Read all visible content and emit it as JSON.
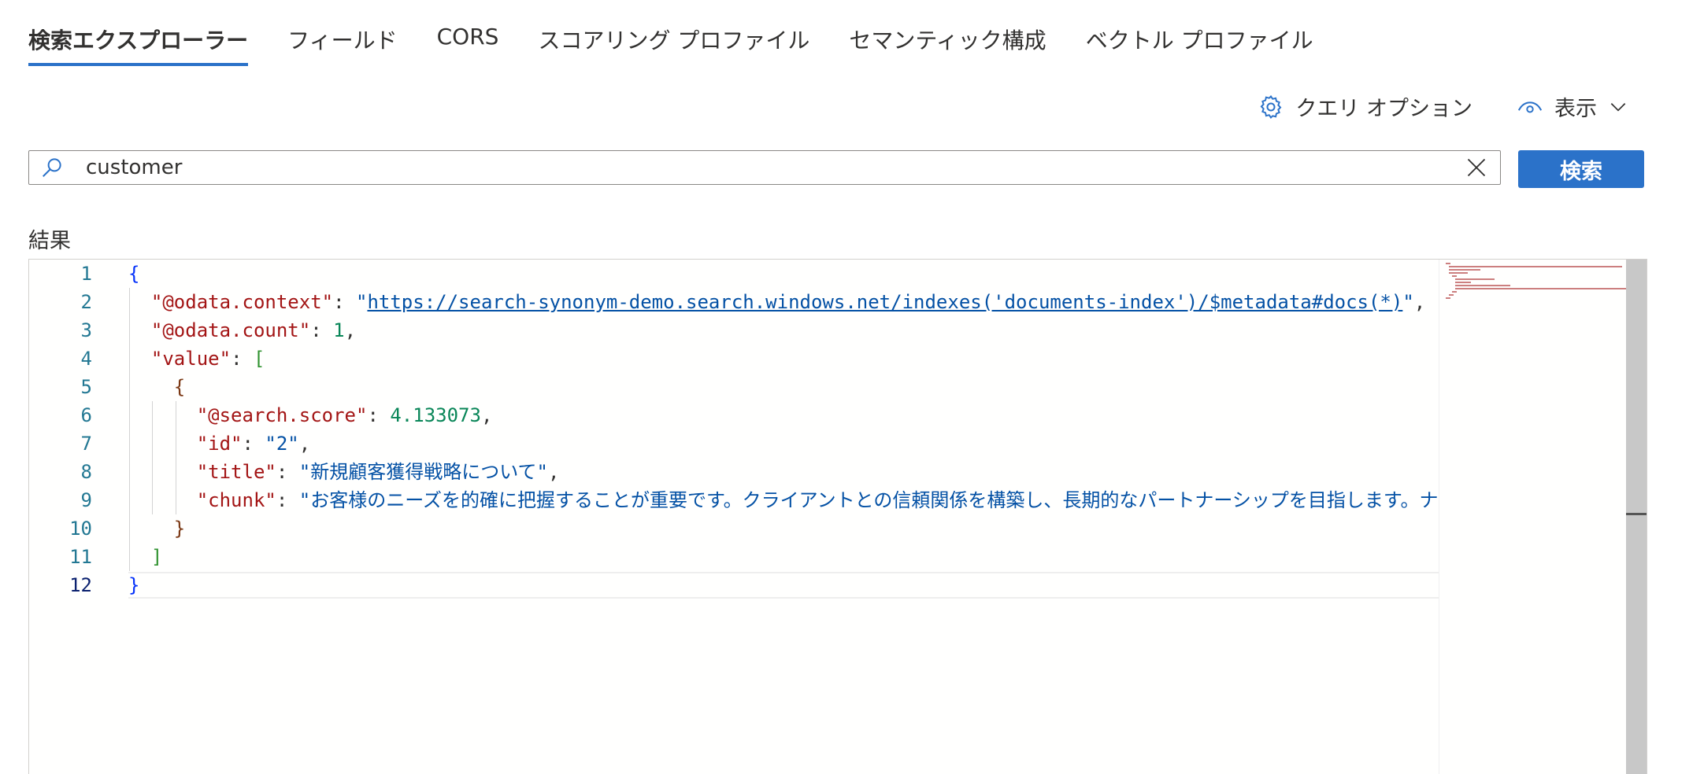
{
  "tabs": [
    {
      "label": "検索エクスプローラー",
      "active": true
    },
    {
      "label": "フィールド",
      "active": false
    },
    {
      "label": "CORS",
      "active": false
    },
    {
      "label": "スコアリング プロファイル",
      "active": false
    },
    {
      "label": "セマンティック構成",
      "active": false
    },
    {
      "label": "ベクトル プロファイル",
      "active": false
    }
  ],
  "toolbar": {
    "query_options_label": "クエリ オプション",
    "view_label": "表示"
  },
  "search": {
    "value": "customer",
    "button_label": "検索"
  },
  "results": {
    "label": "結果",
    "line_numbers": [
      "1",
      "2",
      "3",
      "4",
      "5",
      "6",
      "7",
      "8",
      "9",
      "10",
      "11",
      "12"
    ],
    "current_line": "12",
    "json": {
      "context_key": "\"@odata.context\"",
      "context_url": "https://search-synonym-demo.search.windows.net/indexes('documents-index')/$metadata#docs(*)",
      "count_key": "\"@odata.count\"",
      "count_value": "1",
      "value_key": "\"value\"",
      "score_key": "\"@search.score\"",
      "score_value": "4.133073",
      "id_key": "\"id\"",
      "id_value": "\"2\"",
      "title_key": "\"title\"",
      "title_value": "\"新規顧客獲得戦略について\"",
      "chunk_key": "\"chunk\"",
      "chunk_value": "\"お客様のニーズを的確に把握することが重要です。クライアントとの信頼関係を構築し、長期的なパートナーシップを目指します。ナ"
    }
  },
  "colors": {
    "accent": "#2b72c9",
    "json_key": "#a31515",
    "json_string": "#0451a5",
    "json_number": "#098658"
  }
}
